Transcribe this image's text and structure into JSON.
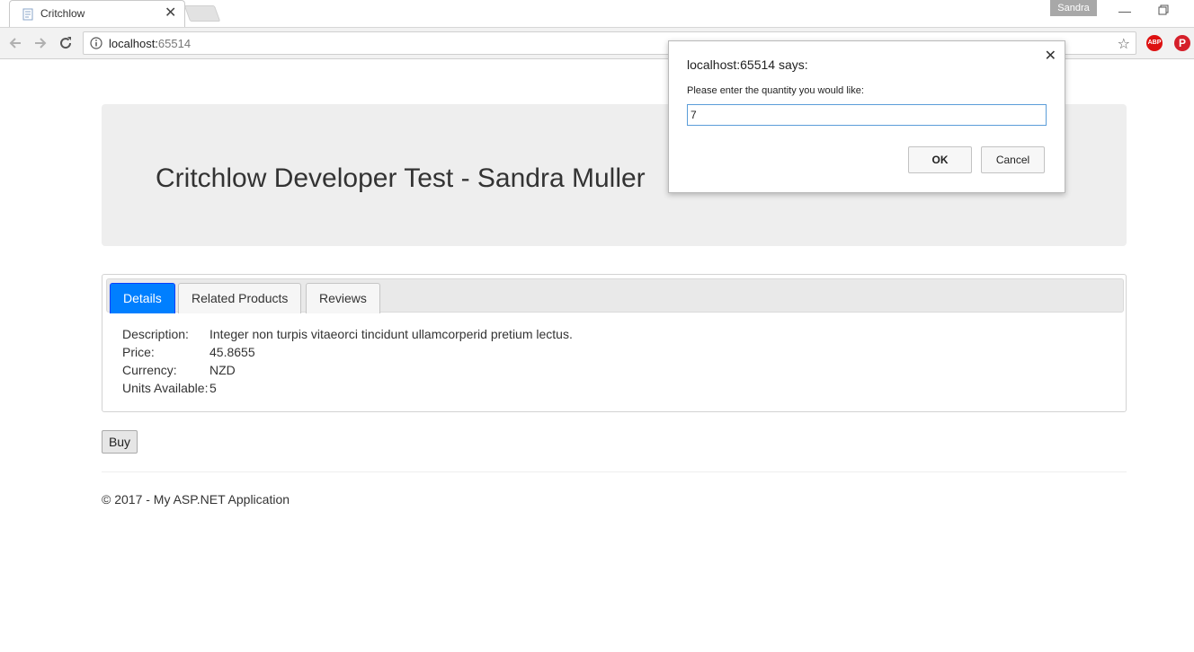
{
  "browser": {
    "tab_title": "Critchlow",
    "profile_name": "Sandra",
    "url_host": "localhost:",
    "url_port": "65514",
    "extensions": {
      "abp_label": "ABP",
      "pinterest_label": "P"
    }
  },
  "page": {
    "heading": "Critchlow Developer Test - Sandra Muller",
    "tabs": [
      {
        "label": "Details",
        "active": true
      },
      {
        "label": "Related Products",
        "active": false
      },
      {
        "label": "Reviews",
        "active": false
      }
    ],
    "details": [
      {
        "label": "Description:",
        "value": "Integer non turpis vitaeorci tincidunt ullamcorperid pretium lectus."
      },
      {
        "label": "Price:",
        "value": "45.8655"
      },
      {
        "label": "Currency:",
        "value": "NZD"
      },
      {
        "label": "Units Available:",
        "value": "5"
      }
    ],
    "buy_label": "Buy",
    "footer": "© 2017 - My ASP.NET Application"
  },
  "dialog": {
    "title": "localhost:65514 says:",
    "message": "Please enter the quantity you would like:",
    "input_value": "7",
    "ok_label": "OK",
    "cancel_label": "Cancel"
  },
  "colors": {
    "active_tab": "#007fff",
    "jumbotron_bg": "#eeeeee",
    "input_focus": "#5b9dd9"
  }
}
